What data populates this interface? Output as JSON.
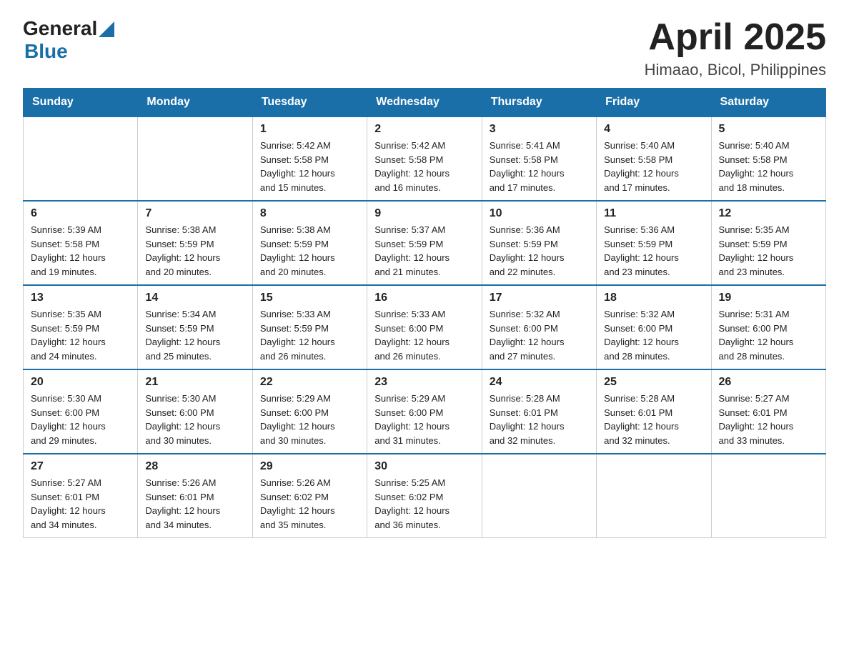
{
  "header": {
    "logo_general": "General",
    "logo_blue": "Blue",
    "month_title": "April 2025",
    "location": "Himaao, Bicol, Philippines"
  },
  "days_of_week": [
    "Sunday",
    "Monday",
    "Tuesday",
    "Wednesday",
    "Thursday",
    "Friday",
    "Saturday"
  ],
  "weeks": [
    [
      {
        "day": "",
        "info": ""
      },
      {
        "day": "",
        "info": ""
      },
      {
        "day": "1",
        "info": "Sunrise: 5:42 AM\nSunset: 5:58 PM\nDaylight: 12 hours\nand 15 minutes."
      },
      {
        "day": "2",
        "info": "Sunrise: 5:42 AM\nSunset: 5:58 PM\nDaylight: 12 hours\nand 16 minutes."
      },
      {
        "day": "3",
        "info": "Sunrise: 5:41 AM\nSunset: 5:58 PM\nDaylight: 12 hours\nand 17 minutes."
      },
      {
        "day": "4",
        "info": "Sunrise: 5:40 AM\nSunset: 5:58 PM\nDaylight: 12 hours\nand 17 minutes."
      },
      {
        "day": "5",
        "info": "Sunrise: 5:40 AM\nSunset: 5:58 PM\nDaylight: 12 hours\nand 18 minutes."
      }
    ],
    [
      {
        "day": "6",
        "info": "Sunrise: 5:39 AM\nSunset: 5:58 PM\nDaylight: 12 hours\nand 19 minutes."
      },
      {
        "day": "7",
        "info": "Sunrise: 5:38 AM\nSunset: 5:59 PM\nDaylight: 12 hours\nand 20 minutes."
      },
      {
        "day": "8",
        "info": "Sunrise: 5:38 AM\nSunset: 5:59 PM\nDaylight: 12 hours\nand 20 minutes."
      },
      {
        "day": "9",
        "info": "Sunrise: 5:37 AM\nSunset: 5:59 PM\nDaylight: 12 hours\nand 21 minutes."
      },
      {
        "day": "10",
        "info": "Sunrise: 5:36 AM\nSunset: 5:59 PM\nDaylight: 12 hours\nand 22 minutes."
      },
      {
        "day": "11",
        "info": "Sunrise: 5:36 AM\nSunset: 5:59 PM\nDaylight: 12 hours\nand 23 minutes."
      },
      {
        "day": "12",
        "info": "Sunrise: 5:35 AM\nSunset: 5:59 PM\nDaylight: 12 hours\nand 23 minutes."
      }
    ],
    [
      {
        "day": "13",
        "info": "Sunrise: 5:35 AM\nSunset: 5:59 PM\nDaylight: 12 hours\nand 24 minutes."
      },
      {
        "day": "14",
        "info": "Sunrise: 5:34 AM\nSunset: 5:59 PM\nDaylight: 12 hours\nand 25 minutes."
      },
      {
        "day": "15",
        "info": "Sunrise: 5:33 AM\nSunset: 5:59 PM\nDaylight: 12 hours\nand 26 minutes."
      },
      {
        "day": "16",
        "info": "Sunrise: 5:33 AM\nSunset: 6:00 PM\nDaylight: 12 hours\nand 26 minutes."
      },
      {
        "day": "17",
        "info": "Sunrise: 5:32 AM\nSunset: 6:00 PM\nDaylight: 12 hours\nand 27 minutes."
      },
      {
        "day": "18",
        "info": "Sunrise: 5:32 AM\nSunset: 6:00 PM\nDaylight: 12 hours\nand 28 minutes."
      },
      {
        "day": "19",
        "info": "Sunrise: 5:31 AM\nSunset: 6:00 PM\nDaylight: 12 hours\nand 28 minutes."
      }
    ],
    [
      {
        "day": "20",
        "info": "Sunrise: 5:30 AM\nSunset: 6:00 PM\nDaylight: 12 hours\nand 29 minutes."
      },
      {
        "day": "21",
        "info": "Sunrise: 5:30 AM\nSunset: 6:00 PM\nDaylight: 12 hours\nand 30 minutes."
      },
      {
        "day": "22",
        "info": "Sunrise: 5:29 AM\nSunset: 6:00 PM\nDaylight: 12 hours\nand 30 minutes."
      },
      {
        "day": "23",
        "info": "Sunrise: 5:29 AM\nSunset: 6:00 PM\nDaylight: 12 hours\nand 31 minutes."
      },
      {
        "day": "24",
        "info": "Sunrise: 5:28 AM\nSunset: 6:01 PM\nDaylight: 12 hours\nand 32 minutes."
      },
      {
        "day": "25",
        "info": "Sunrise: 5:28 AM\nSunset: 6:01 PM\nDaylight: 12 hours\nand 32 minutes."
      },
      {
        "day": "26",
        "info": "Sunrise: 5:27 AM\nSunset: 6:01 PM\nDaylight: 12 hours\nand 33 minutes."
      }
    ],
    [
      {
        "day": "27",
        "info": "Sunrise: 5:27 AM\nSunset: 6:01 PM\nDaylight: 12 hours\nand 34 minutes."
      },
      {
        "day": "28",
        "info": "Sunrise: 5:26 AM\nSunset: 6:01 PM\nDaylight: 12 hours\nand 34 minutes."
      },
      {
        "day": "29",
        "info": "Sunrise: 5:26 AM\nSunset: 6:02 PM\nDaylight: 12 hours\nand 35 minutes."
      },
      {
        "day": "30",
        "info": "Sunrise: 5:25 AM\nSunset: 6:02 PM\nDaylight: 12 hours\nand 36 minutes."
      },
      {
        "day": "",
        "info": ""
      },
      {
        "day": "",
        "info": ""
      },
      {
        "day": "",
        "info": ""
      }
    ]
  ]
}
